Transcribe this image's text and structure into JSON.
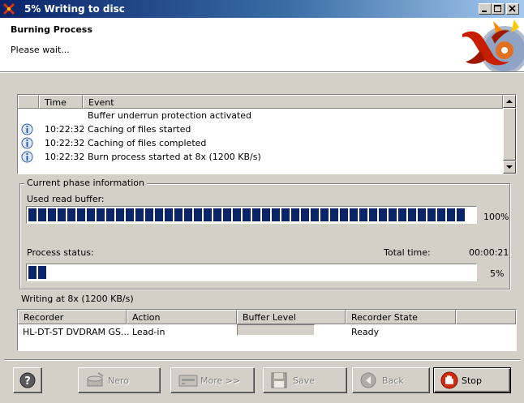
{
  "window": {
    "title": "5% Writing to disc"
  },
  "header": {
    "title": "Burning Process",
    "subtitle": "Please wait..."
  },
  "log": {
    "columns": [
      "",
      "Time",
      "Event"
    ],
    "rows": [
      {
        "icon": "",
        "time": "",
        "event": "Buffer underrun protection activated"
      },
      {
        "icon": "info-icon",
        "time": "10:22:32",
        "event": "Caching of files started"
      },
      {
        "icon": "info-icon",
        "time": "10:22:32",
        "event": "Caching of files completed"
      },
      {
        "icon": "info-icon",
        "time": "10:22:32",
        "event": "Burn process started at 8x (1200 KB/s)"
      }
    ]
  },
  "phase": {
    "legend": "Current phase information",
    "buffer_label": "Used read buffer:",
    "buffer_percent": "100%",
    "buffer_fraction": 1.0,
    "status_label": "Process status:",
    "total_time_label": "Total time:",
    "total_time": "00:00:21",
    "status_percent": "5%",
    "status_fraction": 0.05
  },
  "writing_status": "Writing at 8x (1200 KB/s)",
  "recorder": {
    "columns": [
      "Recorder",
      "Action",
      "Buffer Level",
      "Recorder State"
    ],
    "row": {
      "recorder": "HL-DT-ST DVDRAM GS...",
      "action": "Lead-in",
      "buffer_level": "",
      "state": "Ready"
    }
  },
  "buttons": {
    "help": "",
    "nero": "Nero",
    "more": "More >>",
    "save": "Save",
    "back": "Back",
    "stop": "Stop"
  },
  "colors": {
    "progress": "#0a246a",
    "titlebar": "#0a246a",
    "dialog": "#d4d0c8"
  }
}
